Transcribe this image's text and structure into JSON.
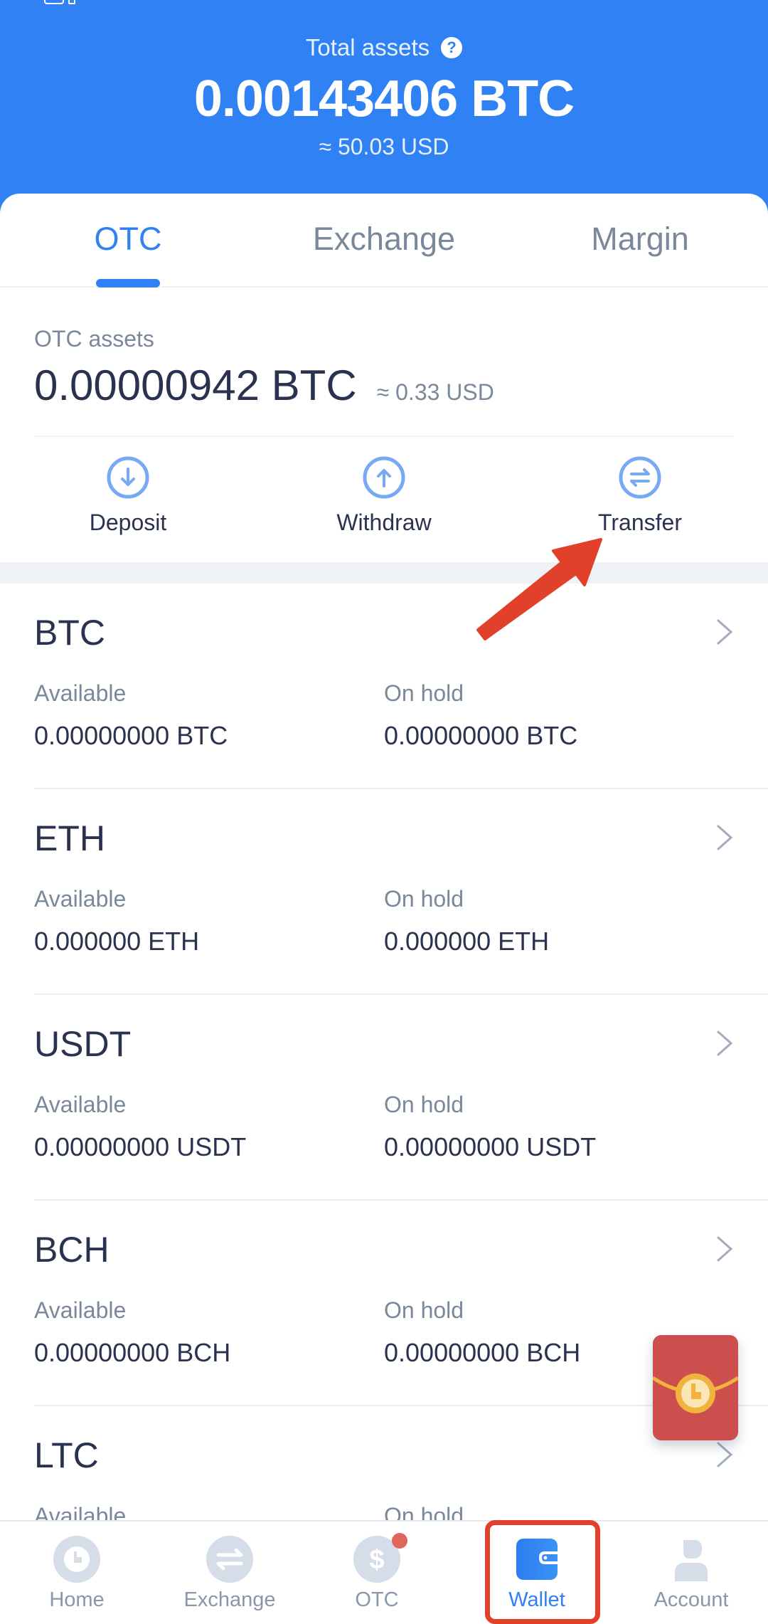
{
  "header": {
    "total_label": "Total assets",
    "help_icon": "question-circle-icon",
    "total_btc": "0.00143406 BTC",
    "total_usd": "≈ 50.03 USD",
    "background_color": "#2f81f4"
  },
  "tabs": [
    {
      "label": "OTC",
      "active": true
    },
    {
      "label": "Exchange",
      "active": false
    },
    {
      "label": "Margin",
      "active": false
    }
  ],
  "otc_summary": {
    "label": "OTC assets",
    "value": "0.00000942 BTC",
    "usd": "≈ 0.33 USD"
  },
  "actions": [
    {
      "label": "Deposit",
      "icon": "arrow-down-circle-icon"
    },
    {
      "label": "Withdraw",
      "icon": "arrow-up-circle-icon"
    },
    {
      "label": "Transfer",
      "icon": "swap-circle-icon"
    }
  ],
  "coins": [
    {
      "name": "BTC",
      "available_label": "Available",
      "available": "0.00000000 BTC",
      "on_hold_label": "On hold",
      "on_hold": "0.00000000 BTC"
    },
    {
      "name": "ETH",
      "available_label": "Available",
      "available": "0.000000 ETH",
      "on_hold_label": "On hold",
      "on_hold": "0.000000 ETH"
    },
    {
      "name": "USDT",
      "available_label": "Available",
      "available": "0.00000000 USDT",
      "on_hold_label": "On hold",
      "on_hold": "0.00000000 USDT"
    },
    {
      "name": "BCH",
      "available_label": "Available",
      "available": "0.00000000 BCH",
      "on_hold_label": "On hold",
      "on_hold": "0.00000000 BCH"
    },
    {
      "name": "LTC",
      "available_label": "Available",
      "available": "",
      "on_hold_label": "On hold",
      "on_hold": ""
    }
  ],
  "floating": {
    "icon": "red-packet-icon"
  },
  "bottom_nav": [
    {
      "label": "Home",
      "icon": "home-icon",
      "active": false
    },
    {
      "label": "Exchange",
      "icon": "exchange-icon",
      "active": false
    },
    {
      "label": "OTC",
      "icon": "dollar-icon",
      "active": false,
      "badge": true
    },
    {
      "label": "Wallet",
      "icon": "wallet-icon",
      "active": true
    },
    {
      "label": "Account",
      "icon": "account-icon",
      "active": false
    }
  ],
  "annotations": {
    "arrow_target": "Transfer",
    "highlight_target": "Wallet",
    "color": "#e1402b"
  }
}
